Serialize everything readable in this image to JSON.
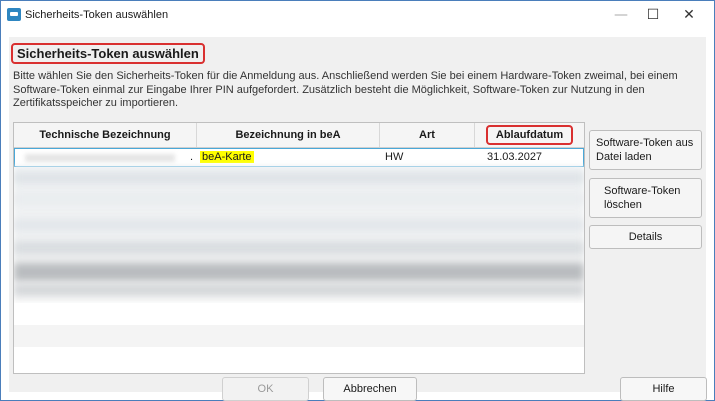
{
  "window": {
    "title": "Sicherheits-Token auswählen",
    "icons": {
      "app": "bea-app-icon",
      "minimize": "minimize-icon",
      "maximize": "maximize-icon",
      "close": "close-icon"
    },
    "glyphs": {
      "minimize": "—",
      "maximize": "☐",
      "close": "✕"
    }
  },
  "dialog": {
    "heading": "Sicherheits-Token auswählen",
    "description": "Bitte wählen Sie den Sicherheits-Token für die Anmeldung aus. Anschließend werden Sie bei einem Hardware-Token zweimal, bei einem Software-Token einmal zur Eingabe Ihrer PIN aufgefordert. Zusätzlich besteht die Möglichkeit, Software-Token zur Nutzung in den Zertifikatsspeicher zu importieren."
  },
  "table": {
    "columns": [
      "Technische Bezeichnung",
      "Bezeichnung in beA",
      "Art",
      "Ablaufdatum"
    ],
    "selected_row": {
      "technical_name_visible": ".",
      "bea_name": "beA-Karte",
      "type": "HW",
      "expiry": "31.03.2027"
    }
  },
  "side_buttons": {
    "load_from_file": "Software-Token aus Datei laden",
    "delete": "Software-Token löschen",
    "details": "Details"
  },
  "footer": {
    "ok": "OK",
    "cancel": "Abbrechen",
    "help": "Hilfe"
  },
  "colors": {
    "highlight_border": "#d93030",
    "selection_highlight": "#ffff00",
    "selected_row_border": "#4aa8d8"
  }
}
